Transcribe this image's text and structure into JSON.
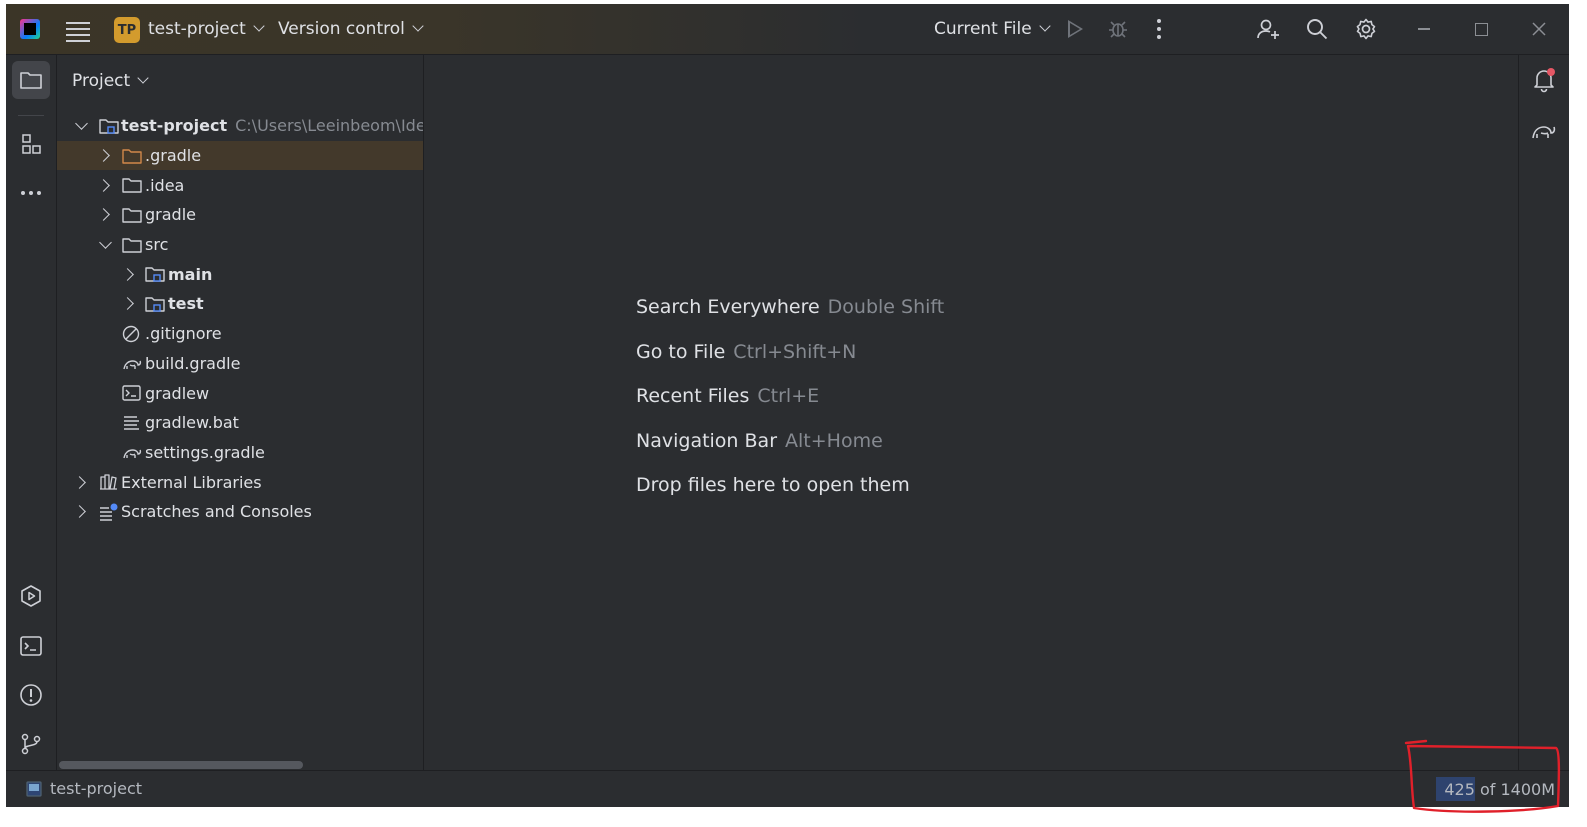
{
  "titlebar": {
    "project_badge": "TP",
    "project_name": "test-project",
    "vcs_label": "Version control",
    "run_config": "Current File",
    "icons": [
      "app-logo-icon",
      "main-menu-icon",
      "run-icon",
      "debug-icon",
      "more-icon",
      "add-user-icon",
      "search-icon",
      "settings-icon",
      "minimize-icon",
      "maximize-icon",
      "close-icon"
    ]
  },
  "panel": {
    "title": "Project"
  },
  "tree": {
    "root_name": "test-project",
    "root_path": "C:\\Users\\Leeinbeom\\Idea",
    "items": [
      {
        "label": ".gradle"
      },
      {
        "label": ".idea"
      },
      {
        "label": "gradle"
      },
      {
        "label": "src"
      },
      {
        "label": "main"
      },
      {
        "label": "test"
      },
      {
        "label": ".gitignore"
      },
      {
        "label": "build.gradle"
      },
      {
        "label": "gradlew"
      },
      {
        "label": "gradlew.bat"
      },
      {
        "label": "settings.gradle"
      },
      {
        "label": "External Libraries"
      },
      {
        "label": "Scratches and Consoles"
      }
    ]
  },
  "editor": {
    "hints": [
      {
        "action": "Search Everywhere",
        "shortcut": "Double Shift"
      },
      {
        "action": "Go to File",
        "shortcut": "Ctrl+Shift+N"
      },
      {
        "action": "Recent Files",
        "shortcut": "Ctrl+E"
      },
      {
        "action": "Navigation Bar",
        "shortcut": "Alt+Home"
      },
      {
        "action": "Drop files here to open them",
        "shortcut": ""
      }
    ]
  },
  "statusbar": {
    "project": "test-project",
    "memory": "425 of 1400M",
    "memory_used_fraction": 0.304
  },
  "colors": {
    "background": "#2b2d30",
    "editor": "#2b2d30",
    "selected_row": "#43392b",
    "accent_badge": "#d39b2d",
    "memory_bar": "#2e436e",
    "annotation": "#e0202a"
  }
}
